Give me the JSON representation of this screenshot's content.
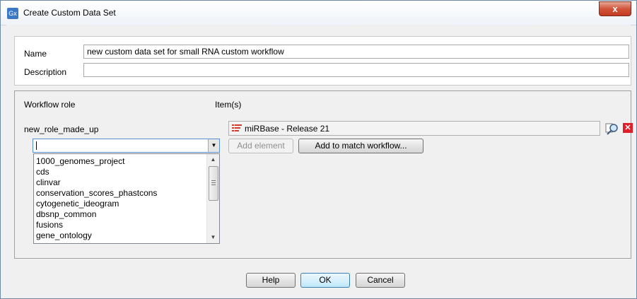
{
  "window": {
    "title": "Create Custom Data Set",
    "app_icon": "Gx",
    "close_symbol": "x"
  },
  "colors": {
    "accent": "#3c7fb1",
    "delete": "#e11d2a",
    "list_icon": "#d43a2a"
  },
  "form": {
    "name_label": "Name",
    "name_value": "new custom data set for small RNA custom workflow",
    "description_label": "Description",
    "description_value": ""
  },
  "roles": {
    "workflow_role_header": "Workflow role",
    "items_header": "Item(s)",
    "role_name": "new_role_made_up",
    "item_value": "miRBase - Release 21",
    "item_icon": "list-icon",
    "find_icon": "find-icon",
    "delete_icon": "delete-icon",
    "combo_value": "",
    "add_element_label": "Add element",
    "add_to_match_label": "Add to match workflow..."
  },
  "dropdown": {
    "options": [
      "1000_genomes_project",
      "cds",
      "clinvar",
      "conservation_scores_phastcons",
      "cytogenetic_ideogram",
      "dbsnp_common",
      "fusions",
      "gene_ontology"
    ]
  },
  "buttons": {
    "help": "Help",
    "ok": "OK",
    "cancel": "Cancel"
  }
}
